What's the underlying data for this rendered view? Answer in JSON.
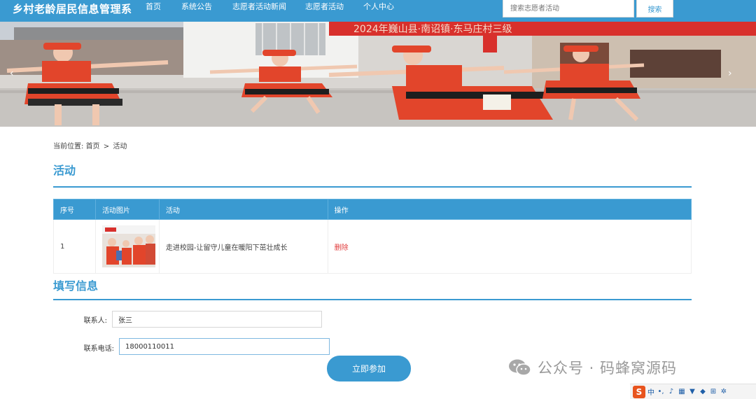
{
  "header": {
    "brand": "乡村老龄居民信息管理系",
    "nav": [
      "首页",
      "系统公告",
      "志愿者活动新闻",
      "志愿者活动",
      "个人中心"
    ],
    "search_placeholder": "搜索志愿者活动",
    "search_button": "搜索"
  },
  "banner": {
    "sign_text": "2024年巍山县·南诏镇·东马庄村三级",
    "icons": {
      "prev": "chevron-left-icon",
      "next": "chevron-right-icon"
    }
  },
  "breadcrumb": {
    "label": "当前位置:",
    "home": "首页",
    "separator": ">",
    "current": "活动"
  },
  "activity_section": {
    "title": "活动",
    "table": {
      "headers": [
        "序号",
        "活动图片",
        "活动",
        "操作"
      ],
      "rows": [
        {
          "index": "1",
          "name": "走进校园-让留守儿童在暖阳下茁壮成长",
          "action": "删除"
        }
      ]
    }
  },
  "form_section": {
    "title": "填写信息",
    "contact_label": "联系人:",
    "contact_value": "张三",
    "phone_label": "联系电话:",
    "phone_value": "18000110011",
    "submit_label": "立即参加"
  },
  "watermark": "公众号 · 码蜂窝源码",
  "ime": {
    "logo": "S",
    "mode": "中"
  },
  "colors": {
    "accent": "#3a9ad1",
    "danger": "#e03b3b",
    "costume_red": "#e2452b"
  }
}
